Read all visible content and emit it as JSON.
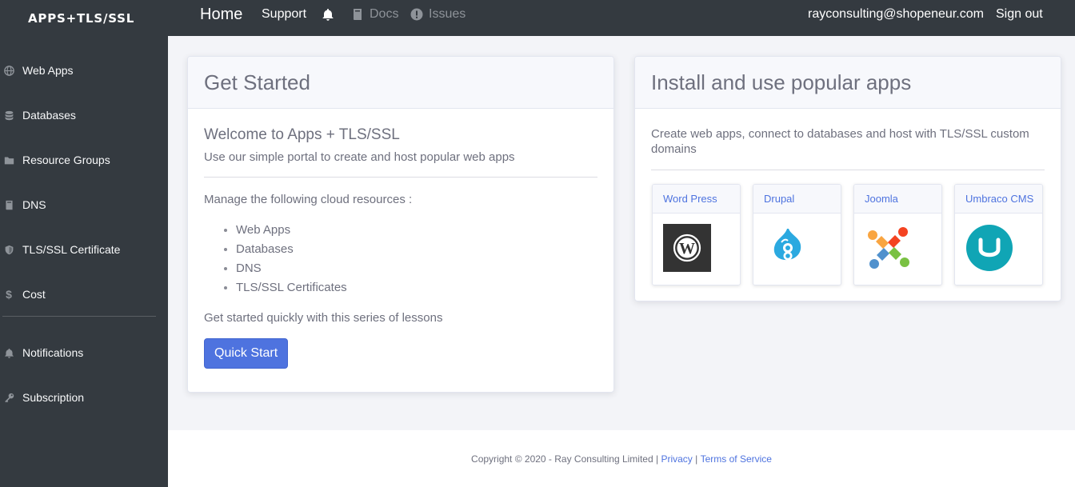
{
  "brand": {
    "title": "APPS+TLS/SSL"
  },
  "sidebar": {
    "items": [
      {
        "label": "Web Apps",
        "icon": "globe-icon"
      },
      {
        "label": "Databases",
        "icon": "database-icon"
      },
      {
        "label": "Resource Groups",
        "icon": "folder-icon"
      },
      {
        "label": "DNS",
        "icon": "book-icon"
      },
      {
        "label": "TLS/SSL Certificate",
        "icon": "shield-icon"
      },
      {
        "label": "Cost",
        "icon": "dollar-icon"
      }
    ],
    "secondary": [
      {
        "label": "Notifications",
        "icon": "bell-icon"
      },
      {
        "label": "Subscription",
        "icon": "key-icon"
      }
    ]
  },
  "topnav": {
    "home": "Home",
    "support": "Support",
    "docs": "Docs",
    "issues": "Issues",
    "user_email": "rayconsulting@shopeneur.com",
    "signout": "Sign out"
  },
  "get_started": {
    "header": "Get Started",
    "welcome_title": "Welcome to Apps + TLS/SSL",
    "welcome_sub": "Use our simple portal to create and host popular web apps",
    "manage_text": "Manage the following cloud resources :",
    "resources": [
      "Web Apps",
      "Databases",
      "DNS",
      "TLS/SSL Certificates"
    ],
    "lessons_text": "Get started quickly with this series of lessons",
    "quick_start_label": "Quick Start"
  },
  "popular_apps": {
    "header": "Install and use popular apps",
    "description": "Create web apps, connect to databases and host with TLS/SSL custom domains",
    "apps": [
      {
        "name": "Word Press",
        "icon": "wordpress-logo"
      },
      {
        "name": "Drupal",
        "icon": "drupal-logo"
      },
      {
        "name": "Joomla",
        "icon": "joomla-logo"
      },
      {
        "name": "Umbraco CMS",
        "icon": "umbraco-logo"
      }
    ]
  },
  "footer": {
    "copyright": "Copyright © 2020 - Ray Consulting Limited |",
    "privacy": "Privacy",
    "separator": "|",
    "terms": "Terms of Service"
  },
  "colors": {
    "sidebar_bg": "#343a40",
    "accent": "#4e73df",
    "page_bg": "#f3f4f8"
  }
}
